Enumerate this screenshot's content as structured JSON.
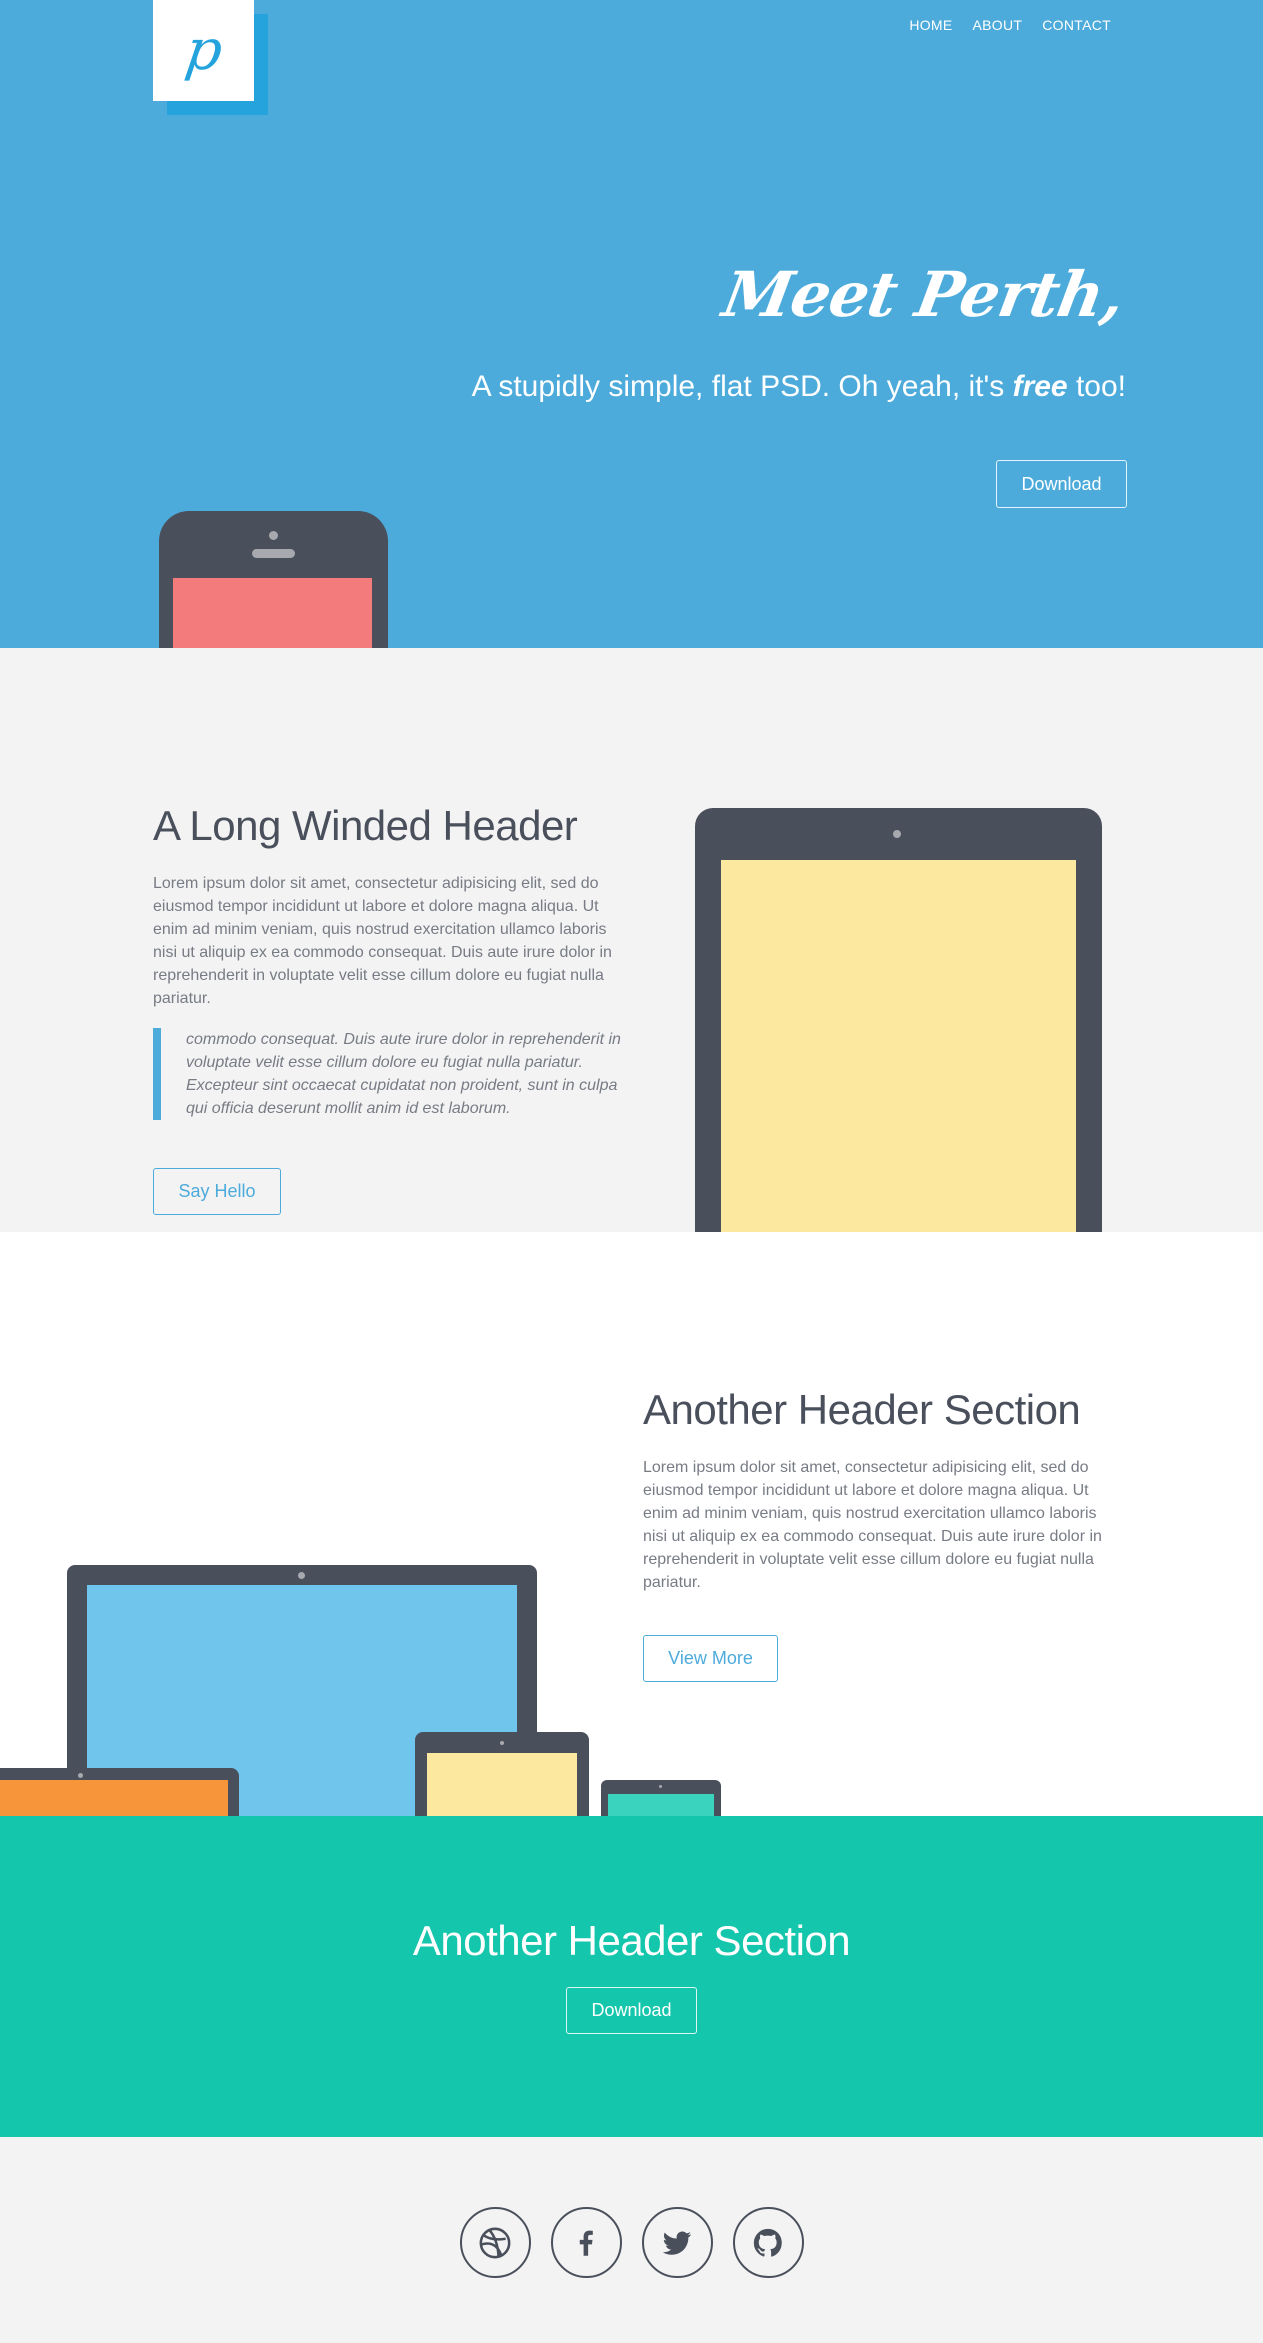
{
  "nav": {
    "logo_letter": "p",
    "items": [
      "HOME",
      "ABOUT",
      "CONTACT"
    ]
  },
  "hero": {
    "title": "Meet Perth,",
    "subtitle_pre": "A stupidly simple, flat PSD. Oh yeah, it's ",
    "subtitle_em": "free",
    "subtitle_post": " too!",
    "button": "Download"
  },
  "section_one": {
    "title": "A Long Winded Header",
    "body": "Lorem ipsum dolor sit amet, consectetur adipisicing elit, sed do eiusmod tempor incididunt ut labore et dolore magna aliqua. Ut enim ad minim veniam, quis nostrud exercitation ullamco laboris nisi ut aliquip ex ea commodo consequat. Duis aute irure dolor in reprehenderit in voluptate velit esse cillum dolore eu fugiat nulla pariatur.",
    "quote": "commodo consequat. Duis aute irure dolor in reprehenderit in voluptate velit esse cillum dolore eu fugiat nulla pariatur. Excepteur sint occaecat cupidatat non proident, sunt in culpa qui officia deserunt mollit anim id est laborum.",
    "button": "Say Hello"
  },
  "section_two": {
    "title": "Another Header Section",
    "body": "Lorem ipsum dolor sit amet, consectetur adipisicing elit, sed do eiusmod tempor incididunt ut labore et dolore magna aliqua. Ut enim ad minim veniam, quis nostrud exercitation ullamco laboris nisi ut aliquip ex ea commodo consequat. Duis aute irure dolor in reprehenderit in voluptate velit esse cillum dolore eu fugiat nulla pariatur.",
    "button": "View More"
  },
  "section_three": {
    "title": "Another Header Section",
    "button": "Download"
  },
  "footer": {
    "icons": [
      "dribbble-icon",
      "facebook-icon",
      "twitter-icon",
      "github-icon"
    ]
  },
  "colors": {
    "hero_blue": "#4dabdc",
    "logo_blue": "#24a3dd",
    "dark_slate": "#4a4f5c",
    "teal": "#14c6ac",
    "phone_screen_red": "#f47b7c",
    "tablet_screen_yellow": "#fce89f",
    "laptop_screen_blue": "#6fc5ec",
    "orange": "#f7953a",
    "mint": "#3ad3be"
  }
}
